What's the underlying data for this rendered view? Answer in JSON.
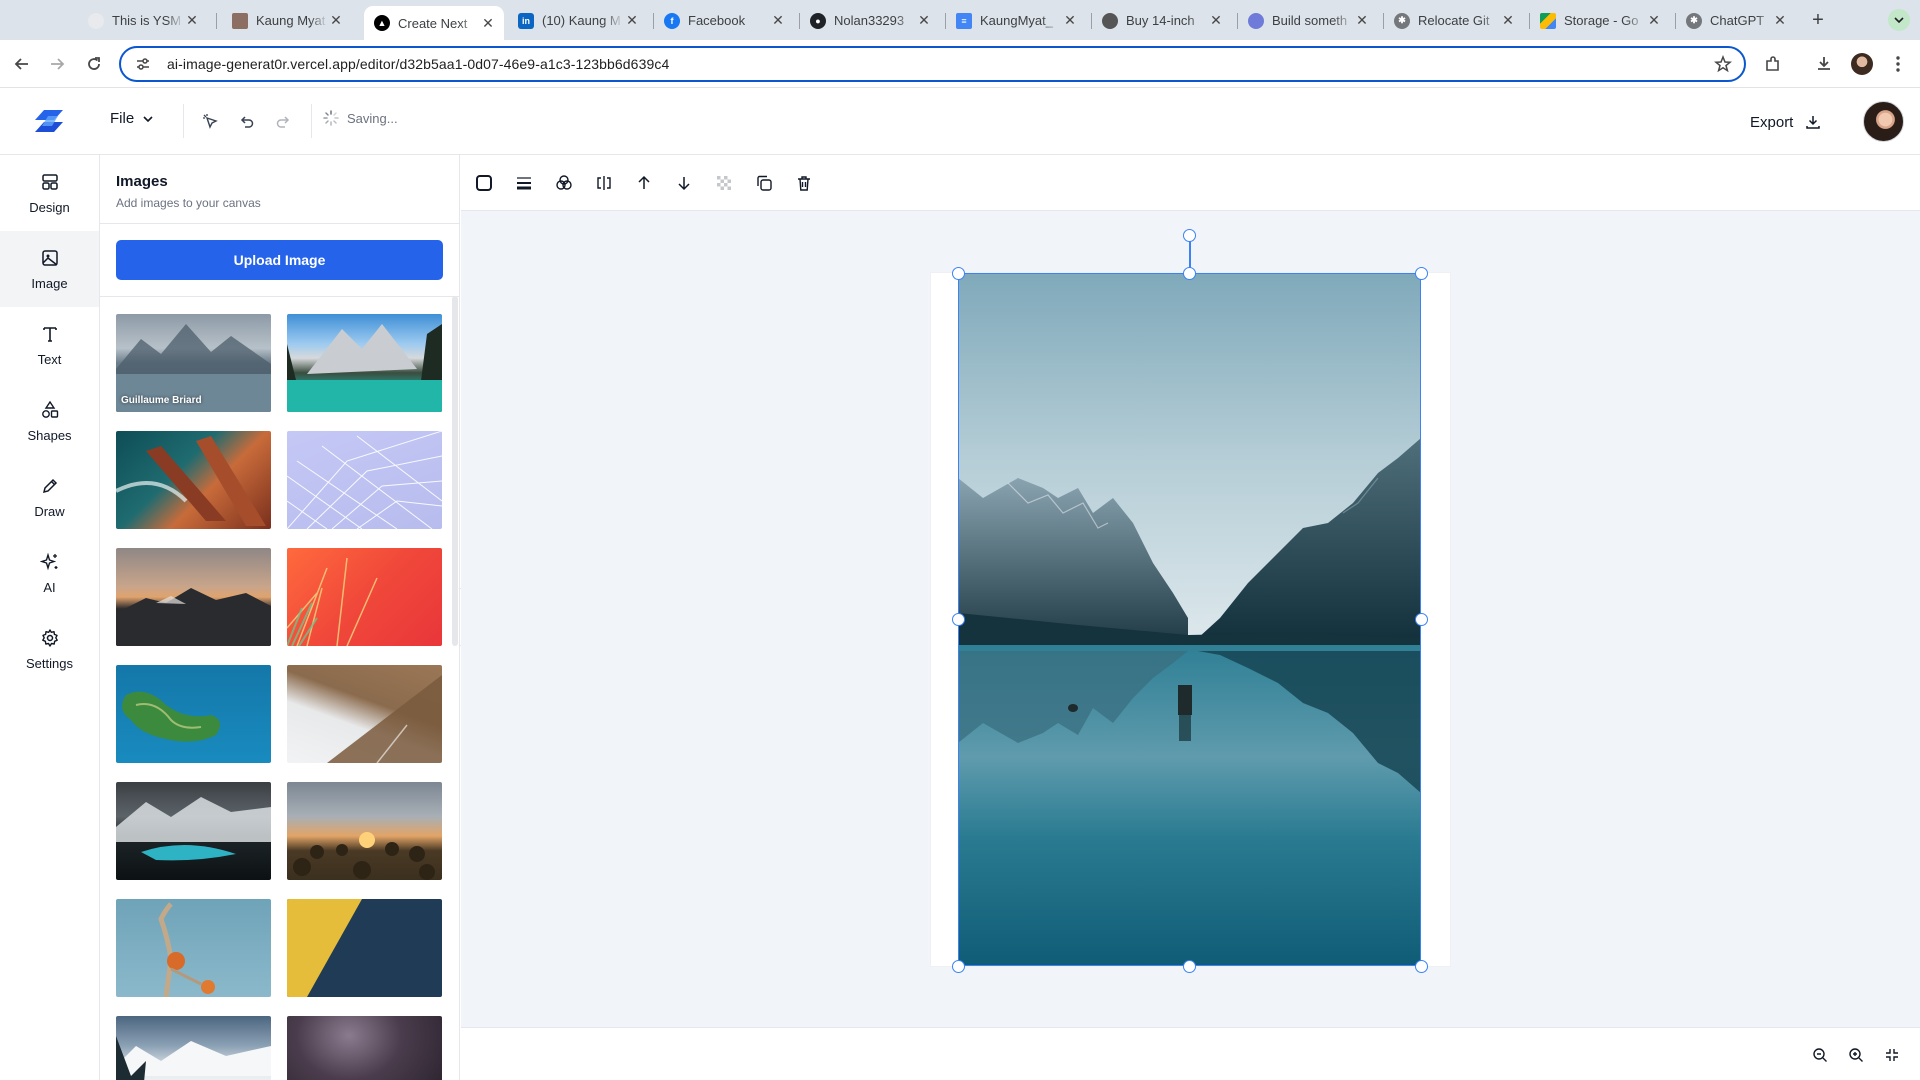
{
  "browser": {
    "tabs": [
      {
        "label": "This is YSM",
        "active": false,
        "icon": "ysm-favicon"
      },
      {
        "label": "Kaung Myat",
        "active": false,
        "icon": "image-favicon"
      },
      {
        "label": "Create Next",
        "active": true,
        "icon": "vercel-favicon"
      },
      {
        "label": "(10) Kaung M",
        "active": false,
        "icon": "linkedin-icon"
      },
      {
        "label": "Facebook",
        "active": false,
        "icon": "facebook-icon"
      },
      {
        "label": "Nolan33293",
        "active": false,
        "icon": "github-icon"
      },
      {
        "label": "KaungMyat_",
        "active": false,
        "icon": "google-docs-icon"
      },
      {
        "label": "Buy 14-inch",
        "active": false,
        "icon": "apple-icon"
      },
      {
        "label": "Build someth",
        "active": false,
        "icon": "globe-icon"
      },
      {
        "label": "Relocate Git",
        "active": false,
        "icon": "chatgpt-icon"
      },
      {
        "label": "Storage - Go",
        "active": false,
        "icon": "google-drive-icon"
      },
      {
        "label": "ChatGPT",
        "active": false,
        "icon": "chatgpt-icon"
      }
    ],
    "url": "ai-image-generat0r.vercel.app/editor/d32b5aa1-0d07-46e9-a1c3-123bb6d639c4"
  },
  "header": {
    "file_label": "File",
    "status_text": "Saving...",
    "export_label": "Export"
  },
  "rail": {
    "items": [
      {
        "label": "Design",
        "icon": "layout-icon",
        "active": false
      },
      {
        "label": "Image",
        "icon": "image-icon",
        "active": true
      },
      {
        "label": "Text",
        "icon": "text-icon",
        "active": false
      },
      {
        "label": "Shapes",
        "icon": "shapes-icon",
        "active": false
      },
      {
        "label": "Draw",
        "icon": "pencil-icon",
        "active": false
      },
      {
        "label": "AI",
        "icon": "sparkles-icon",
        "active": false
      },
      {
        "label": "Settings",
        "icon": "gear-icon",
        "active": false
      }
    ]
  },
  "panel": {
    "title": "Images",
    "subtitle": "Add images to your canvas",
    "upload_label": "Upload Image",
    "thumbnails": [
      {
        "credit": "Guillaume Briard",
        "scene": "misty-lake-mountains"
      },
      {
        "credit": "",
        "scene": "turquoise-lake-peaks"
      },
      {
        "credit": "",
        "scene": "rocky-coast-waves"
      },
      {
        "credit": "",
        "scene": "lavender-geodesic-dome"
      },
      {
        "credit": "",
        "scene": "sunset-mountain-ridge"
      },
      {
        "credit": "",
        "scene": "red-palm-leaves"
      },
      {
        "credit": "",
        "scene": "aerial-island"
      },
      {
        "credit": "",
        "scene": "foggy-forest-slope"
      },
      {
        "credit": "",
        "scene": "glacier-lake-dark"
      },
      {
        "credit": "",
        "scene": "sunflower-field-sunset"
      },
      {
        "credit": "",
        "scene": "orange-fruit-branch"
      },
      {
        "credit": "",
        "scene": "yellow-navy-split"
      },
      {
        "credit": "",
        "scene": "snowy-mountains"
      },
      {
        "credit": "",
        "scene": "night-sky-purple"
      }
    ]
  },
  "canvas_toolbar": {
    "icons": [
      "fill-square-icon",
      "stroke-width-icon",
      "opacity-icon",
      "flip-icon",
      "bring-forward-icon",
      "send-backward-icon",
      "transparency-icon",
      "duplicate-icon",
      "trash-icon"
    ]
  },
  "colors": {
    "accent": "#2563eb",
    "selection": "#3b82f6",
    "canvas_bg": "#f1f5f9"
  }
}
